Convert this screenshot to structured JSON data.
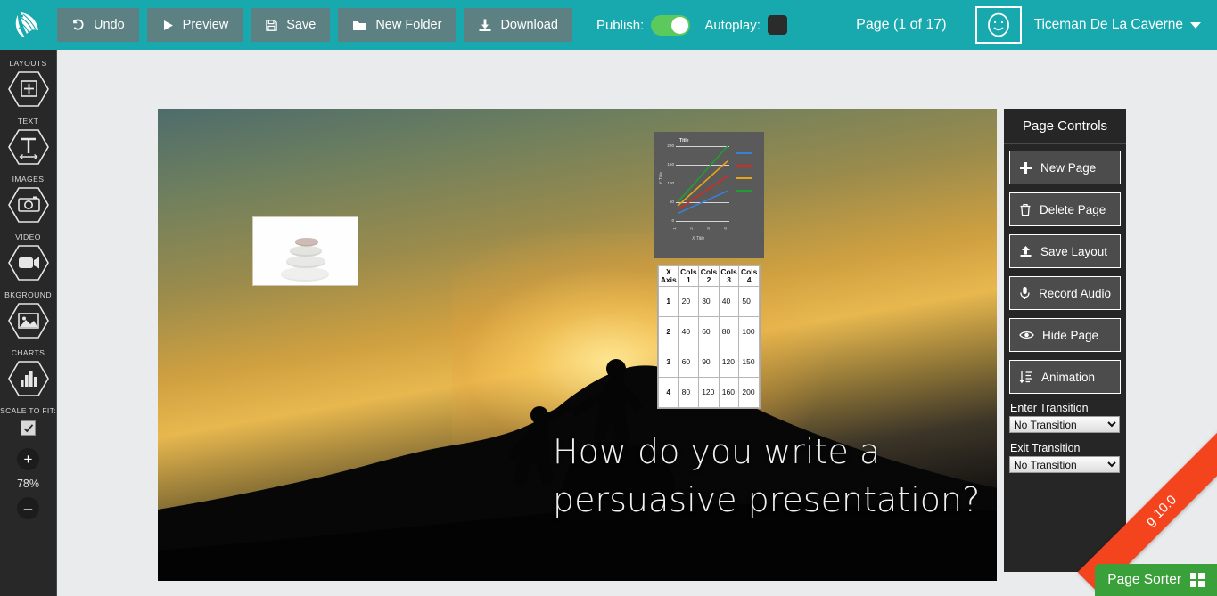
{
  "app": {
    "logo_icon": "feather-logo-icon",
    "brand_color": "#17a9ad"
  },
  "toolbar": {
    "buttons": [
      {
        "label": "Undo",
        "icon": "undo-icon"
      },
      {
        "label": "Preview",
        "icon": "play-icon"
      },
      {
        "label": "Save",
        "icon": "floppy-disk-icon"
      },
      {
        "label": "New Folder",
        "icon": "folder-icon"
      },
      {
        "label": "Download",
        "icon": "download-icon"
      }
    ],
    "publish_label": "Publish:",
    "publish_on": true,
    "autoplay_label": "Autoplay:",
    "autoplay_on": false,
    "page_indicator": "Page (1 of 17)",
    "avatar_icon": "smiley-face-icon",
    "user_name": "Ticeman De La Caverne",
    "user_caret_icon": "chevron-down-icon"
  },
  "sidebar": {
    "items": [
      {
        "label": "LAYOUTS",
        "icon": "plus-in-hexagon-icon"
      },
      {
        "label": "TEXT",
        "icon": "text-tool-icon"
      },
      {
        "label": "IMAGES",
        "icon": "camera-icon"
      },
      {
        "label": "VIDEO",
        "icon": "video-camera-icon"
      },
      {
        "label": "BKGROUND",
        "icon": "picture-icon"
      },
      {
        "label": "CHARTS",
        "icon": "bar-chart-icon"
      }
    ],
    "scale_to_fit_label": "SCALE TO FIT:",
    "scale_to_fit_checked": true,
    "zoom_in_label": "+",
    "zoom_value": "78%",
    "zoom_out_label": "–"
  },
  "page_controls": {
    "header": "Page Controls",
    "buttons": [
      {
        "label": "New Page",
        "icon": "plus-icon"
      },
      {
        "label": "Delete Page",
        "icon": "trash-icon"
      },
      {
        "label": "Save Layout",
        "icon": "upload-icon"
      },
      {
        "label": "Record Audio",
        "icon": "microphone-icon"
      },
      {
        "label": "Hide Page",
        "icon": "eye-icon"
      },
      {
        "label": "Animation",
        "icon": "sort-list-icon"
      }
    ],
    "enter_transition_label": "Enter Transition",
    "enter_transition_value": "No Transition",
    "exit_transition_label": "Exit Transition",
    "exit_transition_value": "No Transition",
    "transition_options": [
      "No Transition"
    ]
  },
  "footer": {
    "ribbon_text": "g 10.0",
    "ribbon_color": "#f4441e",
    "page_sorter_label": "Page Sorter",
    "page_sorter_icon": "grid-icon",
    "page_sorter_color": "#3aa03a"
  },
  "slide": {
    "title_line1": "How do you write a",
    "title_line2": "persuasive presentation?",
    "image_object_alt": "stacked-stones-photo",
    "chart_object_name": "line-chart-object",
    "table_object_name": "data-table-object"
  },
  "chart_data": {
    "type": "line",
    "title": "Title",
    "xlabel": "X Title",
    "ylabel": "Y Title",
    "categories": [
      "1",
      "2",
      "3",
      "4"
    ],
    "x": [
      1,
      2,
      3,
      4
    ],
    "yticks": [
      "0",
      "50",
      "100",
      "150",
      "200"
    ],
    "ylim": [
      0,
      200
    ],
    "xlim": [
      1,
      4
    ],
    "grid": true,
    "legend_position": "right",
    "series": [
      {
        "name": "Cols 1",
        "values": [
          20,
          40,
          60,
          80
        ],
        "color": "#3b7fd4"
      },
      {
        "name": "Cols 2",
        "values": [
          30,
          60,
          90,
          120
        ],
        "color": "#cc2f24"
      },
      {
        "name": "Cols 3",
        "values": [
          40,
          80,
          120,
          160
        ],
        "color": "#e8a317"
      },
      {
        "name": "Cols 4",
        "values": [
          50,
          100,
          150,
          200
        ],
        "color": "#1f9e33"
      }
    ]
  },
  "table_data": {
    "headers": [
      "X Axis",
      "Cols 1",
      "Cols 2",
      "Cols 3",
      "Cols 4"
    ],
    "rows": [
      [
        "1",
        "20",
        "30",
        "40",
        "50"
      ],
      [
        "2",
        "40",
        "60",
        "80",
        "100"
      ],
      [
        "3",
        "60",
        "90",
        "120",
        "150"
      ],
      [
        "4",
        "80",
        "120",
        "160",
        "200"
      ]
    ]
  }
}
